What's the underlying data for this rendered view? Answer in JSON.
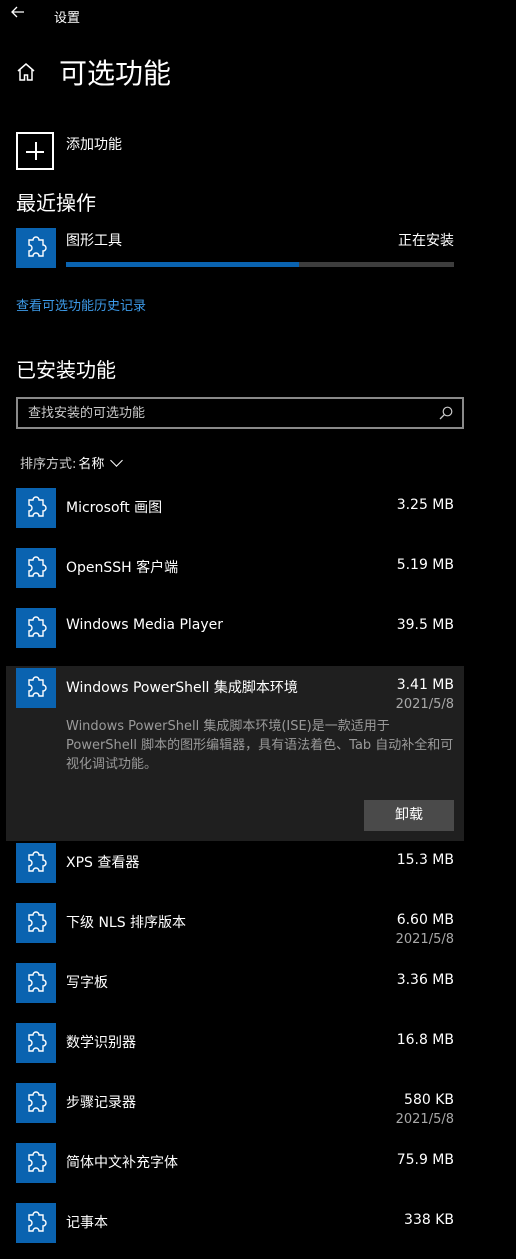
{
  "titlebar": {
    "back_icon": "back-arrow-icon",
    "title": "设置"
  },
  "page": {
    "home_icon": "home-icon",
    "title": "可选功能"
  },
  "add_feature": {
    "label": "添加功能",
    "icon": "plus-icon"
  },
  "recent": {
    "heading": "最近操作",
    "name": "图形工具",
    "status": "正在安装",
    "progress_percent": 60,
    "icon": "puzzle-icon"
  },
  "history_link": "查看可选功能历史记录",
  "installed": {
    "heading": "已安装功能",
    "search_placeholder": "查找安装的可选功能",
    "sort_label": "排序方式:",
    "sort_value": "名称"
  },
  "items": [
    {
      "name": "Microsoft 画图",
      "size": "3.25 MB",
      "date": ""
    },
    {
      "name": "OpenSSH 客户端",
      "size": "5.19 MB",
      "date": ""
    },
    {
      "name": "Windows Media Player",
      "size": "39.5 MB",
      "date": ""
    },
    {
      "name": "Windows PowerShell 集成脚本环境",
      "size": "3.41 MB",
      "date": "2021/5/8",
      "description": "Windows PowerShell 集成脚本环境(ISE)是一款适用于 PowerShell 脚本的图形编辑器，具有语法着色、Tab 自动补全和可视化调试功能。",
      "action": "卸载"
    },
    {
      "name": "XPS 查看器",
      "size": "15.3 MB",
      "date": ""
    },
    {
      "name": "下级 NLS 排序版本",
      "size": "6.60 MB",
      "date": "2021/5/8"
    },
    {
      "name": "写字板",
      "size": "3.36 MB",
      "date": ""
    },
    {
      "name": "数学识别器",
      "size": "16.8 MB",
      "date": ""
    },
    {
      "name": "步骤记录器",
      "size": "580 KB",
      "date": "2021/5/8"
    },
    {
      "name": "简体中文补充字体",
      "size": "75.9 MB",
      "date": ""
    },
    {
      "name": "记事本",
      "size": "338 KB",
      "date": ""
    }
  ],
  "colors": {
    "accent": "#0a63b0",
    "link": "#3d9be9",
    "background": "#000000",
    "expanded_background": "#1f1f1f"
  }
}
